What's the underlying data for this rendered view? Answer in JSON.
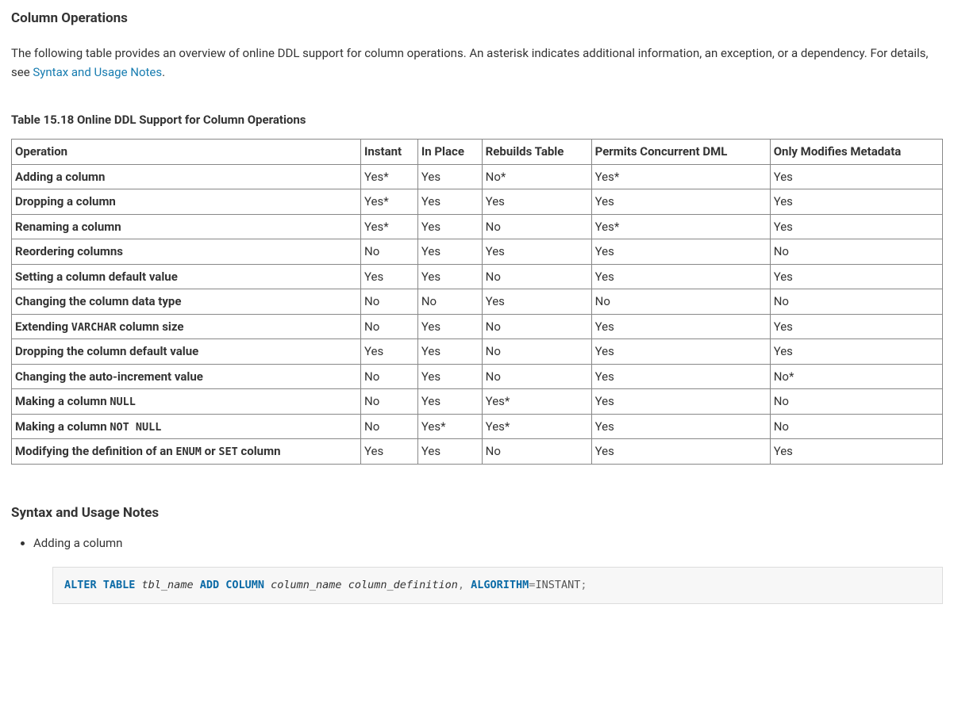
{
  "section_title": "Column Operations",
  "intro_text_before_link": "The following table provides an overview of online DDL support for column operations. An asterisk indicates additional information, an exception, or a dependency. For details, see ",
  "intro_link_text": "Syntax and Usage Notes",
  "intro_text_after_link": ".",
  "table_caption": "Table 15.18 Online DDL Support for Column Operations",
  "columns": [
    "Operation",
    "Instant",
    "In Place",
    "Rebuilds Table",
    "Permits Concurrent DML",
    "Only Modifies Metadata"
  ],
  "rows": [
    {
      "op": [
        {
          "t": "Adding a column"
        }
      ],
      "instant": "Yes*",
      "inplace": "Yes",
      "rebuilds": "No*",
      "concurrent": "Yes*",
      "meta": "Yes"
    },
    {
      "op": [
        {
          "t": "Dropping a column"
        }
      ],
      "instant": "Yes*",
      "inplace": "Yes",
      "rebuilds": "Yes",
      "concurrent": "Yes",
      "meta": "Yes"
    },
    {
      "op": [
        {
          "t": "Renaming a column"
        }
      ],
      "instant": "Yes*",
      "inplace": "Yes",
      "rebuilds": "No",
      "concurrent": "Yes*",
      "meta": "Yes"
    },
    {
      "op": [
        {
          "t": "Reordering columns"
        }
      ],
      "instant": "No",
      "inplace": "Yes",
      "rebuilds": "Yes",
      "concurrent": "Yes",
      "meta": "No"
    },
    {
      "op": [
        {
          "t": "Setting a column default value"
        }
      ],
      "instant": "Yes",
      "inplace": "Yes",
      "rebuilds": "No",
      "concurrent": "Yes",
      "meta": "Yes"
    },
    {
      "op": [
        {
          "t": "Changing the column data type"
        }
      ],
      "instant": "No",
      "inplace": "No",
      "rebuilds": "Yes",
      "concurrent": "No",
      "meta": "No"
    },
    {
      "op": [
        {
          "t": "Extending "
        },
        {
          "t": "VARCHAR",
          "mono": true
        },
        {
          "t": " column size"
        }
      ],
      "instant": "No",
      "inplace": "Yes",
      "rebuilds": "No",
      "concurrent": "Yes",
      "meta": "Yes"
    },
    {
      "op": [
        {
          "t": "Dropping the column default value"
        }
      ],
      "instant": "Yes",
      "inplace": "Yes",
      "rebuilds": "No",
      "concurrent": "Yes",
      "meta": "Yes"
    },
    {
      "op": [
        {
          "t": "Changing the auto-increment value"
        }
      ],
      "instant": "No",
      "inplace": "Yes",
      "rebuilds": "No",
      "concurrent": "Yes",
      "meta": "No*"
    },
    {
      "op": [
        {
          "t": "Making a column "
        },
        {
          "t": "NULL",
          "mono": true
        }
      ],
      "instant": "No",
      "inplace": "Yes",
      "rebuilds": "Yes*",
      "concurrent": "Yes",
      "meta": "No"
    },
    {
      "op": [
        {
          "t": "Making a column "
        },
        {
          "t": "NOT NULL",
          "mono": true
        }
      ],
      "instant": "No",
      "inplace": "Yes*",
      "rebuilds": "Yes*",
      "concurrent": "Yes",
      "meta": "No"
    },
    {
      "op": [
        {
          "t": "Modifying the definition of an "
        },
        {
          "t": "ENUM",
          "mono": true
        },
        {
          "t": " or "
        },
        {
          "t": "SET",
          "mono": true
        },
        {
          "t": " column"
        }
      ],
      "instant": "Yes",
      "inplace": "Yes",
      "rebuilds": "No",
      "concurrent": "Yes",
      "meta": "Yes"
    }
  ],
  "notes_heading": "Syntax and Usage Notes",
  "notes": [
    {
      "label": "Adding a column"
    }
  ],
  "code": {
    "tokens": [
      {
        "t": "ALTER TABLE",
        "c": "kw"
      },
      {
        "t": " "
      },
      {
        "t": "tbl_name",
        "c": "ident"
      },
      {
        "t": " "
      },
      {
        "t": "ADD COLUMN",
        "c": "kw"
      },
      {
        "t": " "
      },
      {
        "t": "column_name",
        "c": "ident"
      },
      {
        "t": " "
      },
      {
        "t": "column_definition",
        "c": "ident"
      },
      {
        "t": ",",
        "c": "punct"
      },
      {
        "t": " "
      },
      {
        "t": "ALGORITHM",
        "c": "kw"
      },
      {
        "t": "=",
        "c": "punct"
      },
      {
        "t": "INSTANT",
        "c": "val"
      },
      {
        "t": ";",
        "c": "punct"
      }
    ]
  }
}
